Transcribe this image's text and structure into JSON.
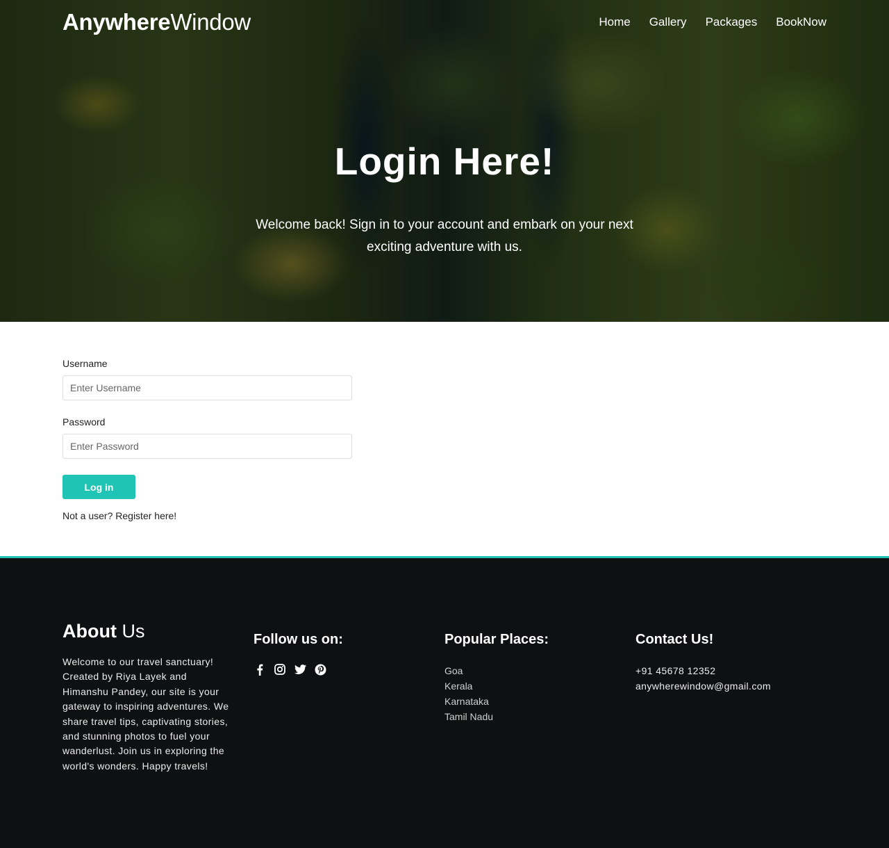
{
  "nav": {
    "brand_bold": "Anywhere",
    "brand_light": "Window",
    "links": [
      "Home",
      "Gallery",
      "Packages",
      "BookNow"
    ]
  },
  "hero": {
    "title": "Login Here!",
    "subtitle": "Welcome back! Sign in to your account and embark on your next exciting adventure with us."
  },
  "form": {
    "username_label": "Username",
    "username_placeholder": "Enter Username",
    "password_label": "Password",
    "password_placeholder": "Enter Password",
    "login_label": "Log in",
    "register_text": "Not a user? Register here!"
  },
  "footer": {
    "about_bold": "About",
    "about_light": " Us",
    "about_text": "Welcome to our travel sanctuary! Created by Riya Layek and Himanshu Pandey, our site is your gateway to inspiring adventures. We share travel tips, captivating stories, and stunning photos to fuel your wanderlust. Join us in exploring the world's wonders. Happy travels!",
    "follow_title": "Follow us on:",
    "social_icons": [
      "facebook-icon",
      "instagram-icon",
      "twitter-icon",
      "pinterest-icon"
    ],
    "places_title": "Popular Places:",
    "places": [
      "Goa",
      "Kerala",
      "Karnataka",
      "Tamil Nadu"
    ],
    "contact_title": "Contact Us!",
    "phone": "+91 45678 12352",
    "email": "anywherewindow@gmail.com"
  },
  "colors": {
    "accent": "#20c4b4",
    "footer_bg": "#0e1011"
  }
}
